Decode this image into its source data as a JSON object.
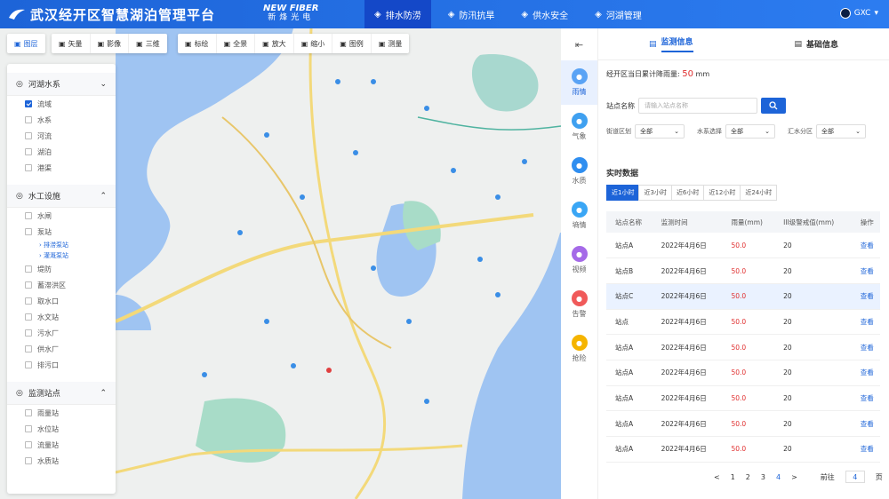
{
  "header": {
    "title": "武汉经开区智慧湖泊管理平台",
    "brand_en": "NEW FIBER",
    "brand_cn": "新烽光电",
    "nav": [
      {
        "label": "排水防涝",
        "icon": "drainage-icon",
        "active": true
      },
      {
        "label": "防汛抗旱",
        "icon": "flood-icon",
        "active": false
      },
      {
        "label": "供水安全",
        "icon": "shield-icon",
        "active": false
      },
      {
        "label": "河湖管理",
        "icon": "river-icon",
        "active": false
      }
    ],
    "user": "GXC"
  },
  "toolbar1": [
    {
      "label": "图层",
      "icon": "layers-icon",
      "primary": true
    }
  ],
  "toolbar2": [
    {
      "label": "矢量",
      "icon": "vector-icon"
    },
    {
      "label": "影像",
      "icon": "globe-icon"
    },
    {
      "label": "三维",
      "icon": "cube-icon"
    }
  ],
  "toolbar3": [
    {
      "label": "标绘",
      "icon": "pen-icon"
    },
    {
      "label": "全景",
      "icon": "panorama-icon"
    },
    {
      "label": "放大",
      "icon": "zoom-in-icon"
    },
    {
      "label": "缩小",
      "icon": "zoom-out-icon"
    },
    {
      "label": "图例",
      "icon": "legend-icon"
    },
    {
      "label": "测量",
      "icon": "ruler-icon"
    }
  ],
  "sidebar": {
    "groups": [
      {
        "title": "河湖水系",
        "icon": "water-system-icon",
        "items": [
          {
            "label": "流域",
            "checked": true
          },
          {
            "label": "水系",
            "checked": false
          },
          {
            "label": "河流",
            "checked": false
          },
          {
            "label": "湖泊",
            "checked": false
          },
          {
            "label": "港渠",
            "checked": false
          }
        ]
      },
      {
        "title": "水工设施",
        "icon": "facility-icon",
        "items": [
          {
            "label": "水闸",
            "checked": false
          },
          {
            "label": "泵站",
            "checked": false,
            "subs": [
              "排涝泵站",
              "灌溉泵站"
            ]
          },
          {
            "label": "堤防",
            "checked": false
          },
          {
            "label": "蓄滞洪区",
            "checked": false
          },
          {
            "label": "取水口",
            "checked": false
          },
          {
            "label": "水文站",
            "checked": false
          },
          {
            "label": "污水厂",
            "checked": false
          },
          {
            "label": "供水厂",
            "checked": false
          },
          {
            "label": "排污口",
            "checked": false
          }
        ]
      },
      {
        "title": "监测站点",
        "icon": "station-icon",
        "items": [
          {
            "label": "雨量站",
            "checked": false
          },
          {
            "label": "水位站",
            "checked": false
          },
          {
            "label": "流量站",
            "checked": false
          },
          {
            "label": "水质站",
            "checked": false
          }
        ]
      }
    ]
  },
  "rail": {
    "items": [
      {
        "label": "雨情",
        "icon": "rain-icon",
        "color": "#5aa3f5",
        "active": true
      },
      {
        "label": "气象",
        "icon": "weather-icon",
        "color": "#3fa0f0",
        "active": false
      },
      {
        "label": "水质",
        "icon": "drop-icon",
        "color": "#2f8ef0",
        "active": false
      },
      {
        "label": "墒情",
        "icon": "soil-icon",
        "color": "#3aa6f5",
        "active": false
      },
      {
        "label": "视频",
        "icon": "video-icon",
        "color": "#a56ae8",
        "active": false
      },
      {
        "label": "告警",
        "icon": "alarm-icon",
        "color": "#f05a5a",
        "active": false
      },
      {
        "label": "抢险",
        "icon": "warning-icon",
        "color": "#f5b400",
        "active": false
      }
    ]
  },
  "panel": {
    "tabs": [
      {
        "label": "监测信息",
        "icon": "monitor-icon"
      },
      {
        "label": "基础信息",
        "icon": "doc-icon"
      }
    ],
    "rain_label": "经开区当日累计降雨量:",
    "rain_value": "50",
    "rain_unit": "mm",
    "search_label": "站点名称",
    "search_placeholder": "请输入站点名称",
    "filters": [
      {
        "label": "街道区划",
        "value": "全部"
      },
      {
        "label": "水系选择",
        "value": "全部"
      },
      {
        "label": "汇水分区",
        "value": "全部"
      }
    ],
    "realtime_title": "实时数据",
    "range_tabs": [
      "近1小时",
      "近3小时",
      "近6小时",
      "近12小时",
      "近24小时"
    ],
    "columns": [
      "站点名称",
      "监测时间",
      "雨量(mm)",
      "III级警戒值(mm)",
      "操作"
    ],
    "rows": [
      [
        "站点A",
        "2022年4月6日",
        "50.0",
        "20",
        "查看"
      ],
      [
        "站点B",
        "2022年4月6日",
        "50.0",
        "20",
        "查看"
      ],
      [
        "站点C",
        "2022年4月6日",
        "50.0",
        "20",
        "查看"
      ],
      [
        "站点",
        "2022年4月6日",
        "50.0",
        "20",
        "查看"
      ],
      [
        "站点A",
        "2022年4月6日",
        "50.0",
        "20",
        "查看"
      ],
      [
        "站点A",
        "2022年4月6日",
        "50.0",
        "20",
        "查看"
      ],
      [
        "站点A",
        "2022年4月6日",
        "50.0",
        "20",
        "查看"
      ],
      [
        "站点A",
        "2022年4月6日",
        "50.0",
        "20",
        "查看"
      ],
      [
        "站点A",
        "2022年4月6日",
        "50.0",
        "20",
        "查看"
      ]
    ],
    "pager": {
      "prev": "<",
      "pages": [
        "1",
        "2",
        "3",
        "4"
      ],
      "current": "4",
      "next": ">",
      "goto": "前往",
      "value": "4",
      "suffix": "页"
    }
  }
}
